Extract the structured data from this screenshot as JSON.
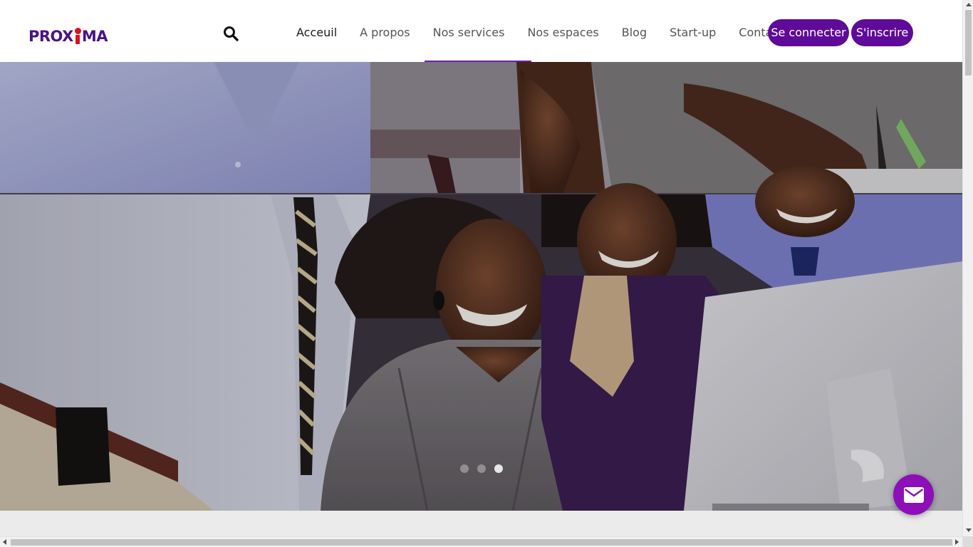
{
  "brand": {
    "logo_left": "PROX",
    "logo_right": "MA"
  },
  "header": {
    "nav": [
      {
        "label": "Acceuil",
        "active": true
      },
      {
        "label": "A propos",
        "active": false
      },
      {
        "label": "Nos services",
        "active": false
      },
      {
        "label": "Nos espaces",
        "active": false
      },
      {
        "label": "Blog",
        "active": false
      },
      {
        "label": "Start-up",
        "active": false
      },
      {
        "label": "Contact",
        "active": false
      }
    ],
    "login_label": "Se connecter",
    "signup_label": "S'inscrire"
  },
  "hero": {
    "slide_count": 3,
    "active_slide": 3
  },
  "colors": {
    "brand_purple": "#5f0a99",
    "logo_purple": "#4b1288",
    "logo_red": "#e10f1d",
    "fab_purple": "#8c0fb8"
  },
  "icons": {
    "search": "magnifier-icon",
    "mail": "envelope-icon"
  }
}
